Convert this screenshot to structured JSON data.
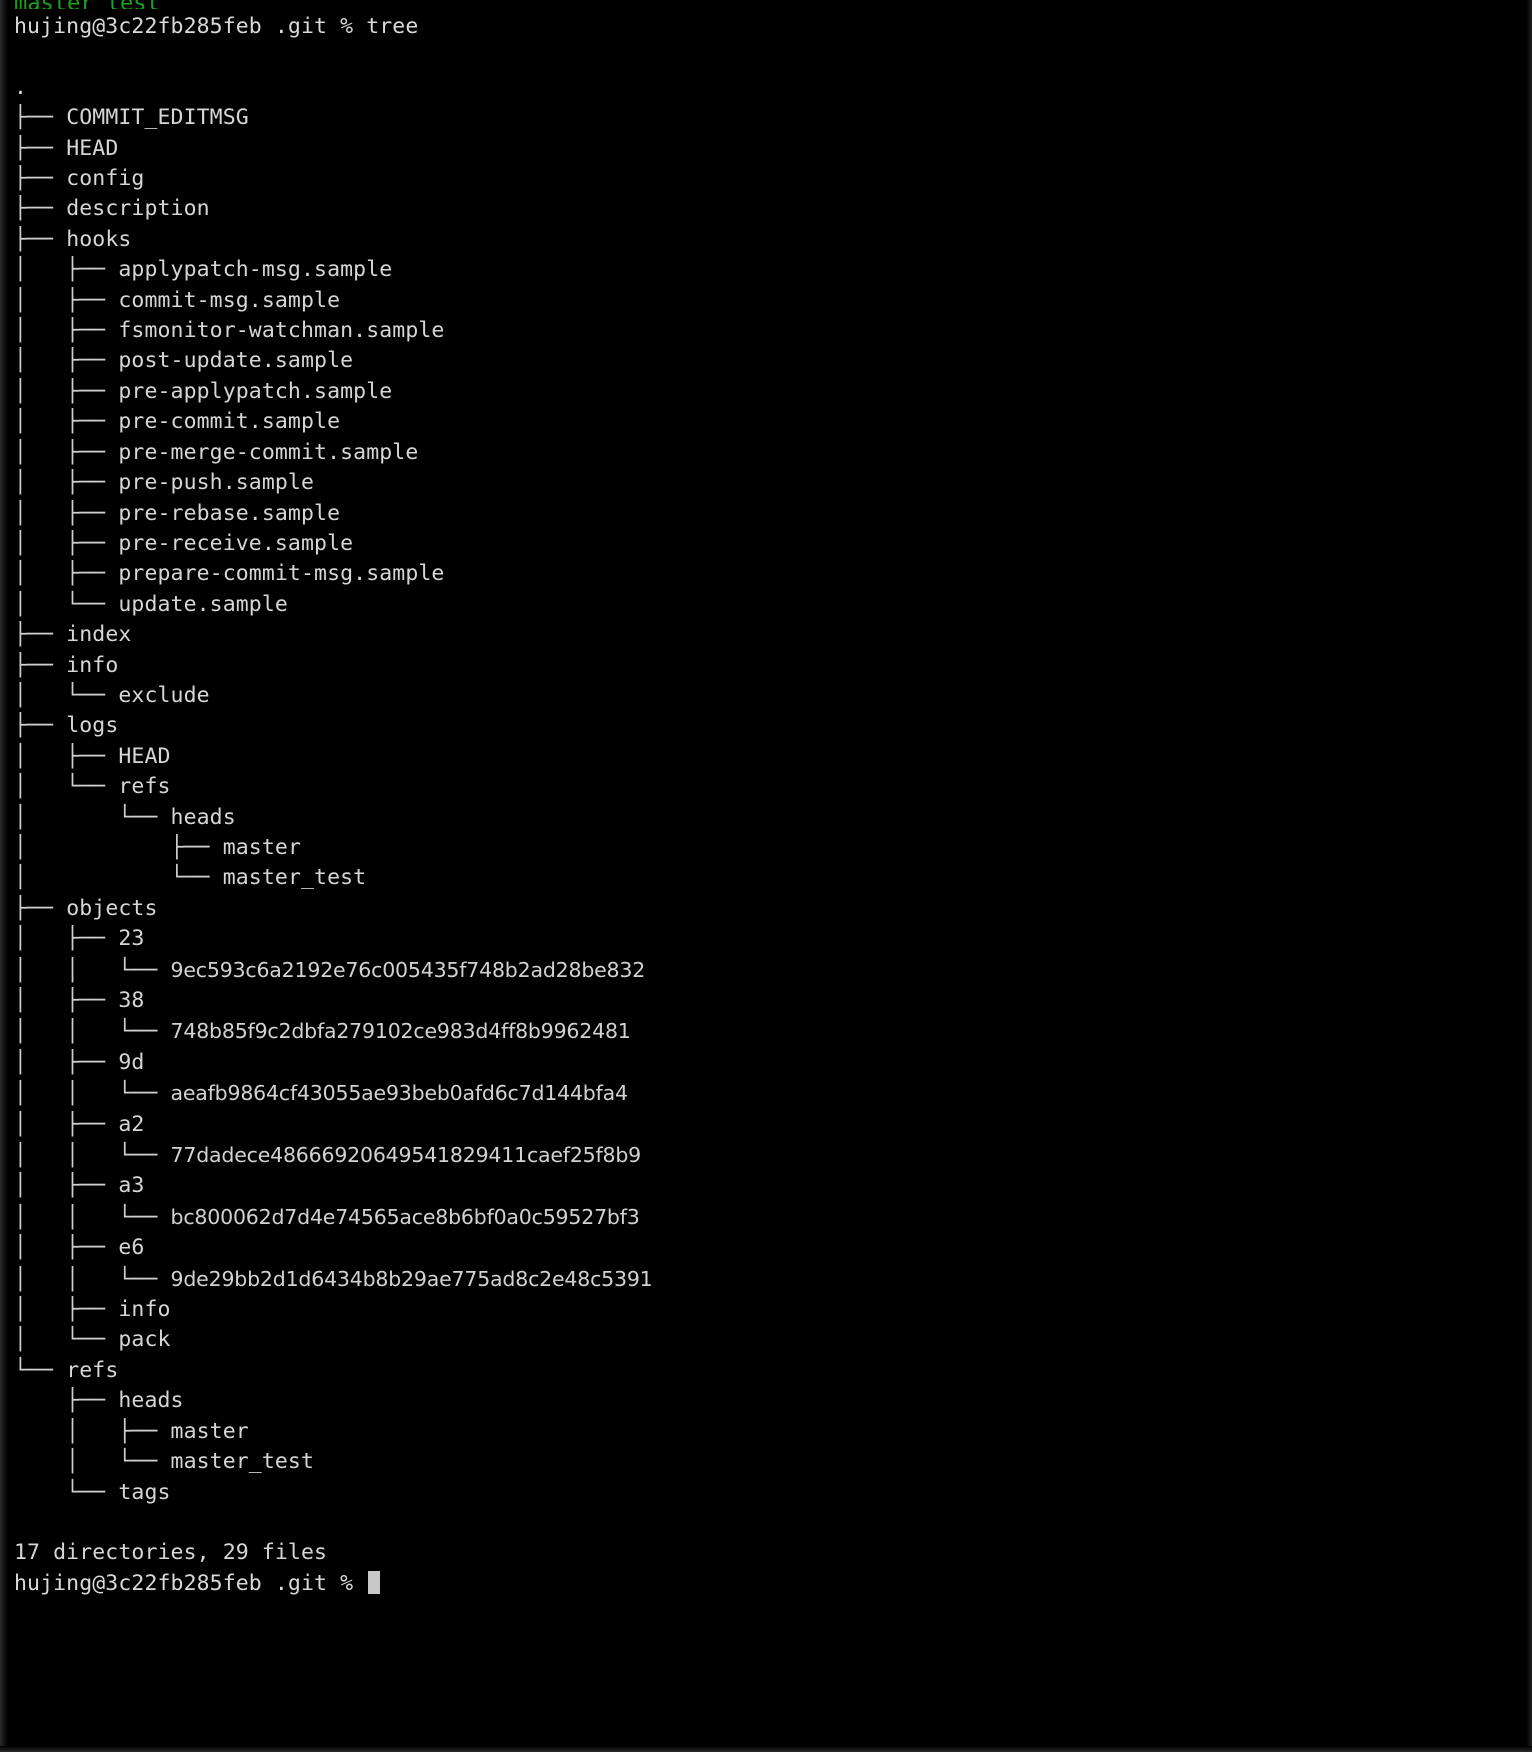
{
  "terminal": {
    "window_title_clipped": "master_test",
    "colors": {
      "background": "#000000",
      "foreground": "#d6d6d6",
      "branch_green": "#19a31a",
      "cursor": "#c8c8c8"
    },
    "prompt_user_host": "hujing@3c22fb285feb",
    "prompt_cwd": ".git",
    "prompt_symbol": "%",
    "command": "tree",
    "command_line": "hujing@3c22fb285feb .git % tree",
    "root": ".",
    "summary": "17 directories, 29 files",
    "directories_count": 17,
    "files_count": 29,
    "final_prompt": "hujing@3c22fb285feb .git % "
  },
  "tree_lines": [
    {
      "guide": "",
      "name": ".",
      "style": "plain"
    },
    {
      "guide": "├── ",
      "name": "COMMIT_EDITMSG",
      "style": "plain"
    },
    {
      "guide": "├── ",
      "name": "HEAD",
      "style": "plain"
    },
    {
      "guide": "├── ",
      "name": "config",
      "style": "plain"
    },
    {
      "guide": "├── ",
      "name": "description",
      "style": "plain"
    },
    {
      "guide": "├── ",
      "name": "hooks",
      "style": "plain"
    },
    {
      "guide": "│   ├── ",
      "name": "applypatch-msg.sample",
      "style": "plain"
    },
    {
      "guide": "│   ├── ",
      "name": "commit-msg.sample",
      "style": "plain"
    },
    {
      "guide": "│   ├── ",
      "name": "fsmonitor-watchman.sample",
      "style": "plain"
    },
    {
      "guide": "│   ├── ",
      "name": "post-update.sample",
      "style": "plain"
    },
    {
      "guide": "│   ├── ",
      "name": "pre-applypatch.sample",
      "style": "plain"
    },
    {
      "guide": "│   ├── ",
      "name": "pre-commit.sample",
      "style": "plain"
    },
    {
      "guide": "│   ├── ",
      "name": "pre-merge-commit.sample",
      "style": "plain"
    },
    {
      "guide": "│   ├── ",
      "name": "pre-push.sample",
      "style": "plain"
    },
    {
      "guide": "│   ├── ",
      "name": "pre-rebase.sample",
      "style": "plain"
    },
    {
      "guide": "│   ├── ",
      "name": "pre-receive.sample",
      "style": "plain"
    },
    {
      "guide": "│   ├── ",
      "name": "prepare-commit-msg.sample",
      "style": "plain"
    },
    {
      "guide": "│   └── ",
      "name": "update.sample",
      "style": "plain"
    },
    {
      "guide": "├── ",
      "name": "index",
      "style": "plain"
    },
    {
      "guide": "├── ",
      "name": "info",
      "style": "plain"
    },
    {
      "guide": "│   └── ",
      "name": "exclude",
      "style": "plain"
    },
    {
      "guide": "├── ",
      "name": "logs",
      "style": "plain"
    },
    {
      "guide": "│   ├── ",
      "name": "HEAD",
      "style": "plain"
    },
    {
      "guide": "│   └── ",
      "name": "refs",
      "style": "plain"
    },
    {
      "guide": "│       └── ",
      "name": "heads",
      "style": "plain"
    },
    {
      "guide": "│           ├── ",
      "name": "master",
      "style": "plain"
    },
    {
      "guide": "│           └── ",
      "name": "master_test",
      "style": "plain"
    },
    {
      "guide": "├── ",
      "name": "objects",
      "style": "plain"
    },
    {
      "guide": "│   ├── ",
      "name": "23",
      "style": "plain"
    },
    {
      "guide": "│   │   └── ",
      "name": "9ec593c6a2192e76c005435f748b2ad28be832",
      "style": "hash"
    },
    {
      "guide": "│   ├── ",
      "name": "38",
      "style": "plain"
    },
    {
      "guide": "│   │   └── ",
      "name": "748b85f9c2dbfa279102ce983d4ff8b9962481",
      "style": "hash"
    },
    {
      "guide": "│   ├── ",
      "name": "9d",
      "style": "plain"
    },
    {
      "guide": "│   │   └── ",
      "name": "aeafb9864cf43055ae93beb0afd6c7d144bfa4",
      "style": "hash"
    },
    {
      "guide": "│   ├── ",
      "name": "a2",
      "style": "plain"
    },
    {
      "guide": "│   │   └── ",
      "name": "77dadece48666920649541829411caef25f8b9",
      "style": "hash"
    },
    {
      "guide": "│   ├── ",
      "name": "a3",
      "style": "plain"
    },
    {
      "guide": "│   │   └── ",
      "name": "bc800062d7d4e74565ace8b6bf0a0c59527bf3",
      "style": "hash"
    },
    {
      "guide": "│   ├── ",
      "name": "e6",
      "style": "plain"
    },
    {
      "guide": "│   │   └── ",
      "name": "9de29bb2d1d6434b8b29ae775ad8c2e48c5391",
      "style": "hash"
    },
    {
      "guide": "│   ├── ",
      "name": "info",
      "style": "plain"
    },
    {
      "guide": "│   └── ",
      "name": "pack",
      "style": "plain"
    },
    {
      "guide": "└── ",
      "name": "refs",
      "style": "plain"
    },
    {
      "guide": "    ├── ",
      "name": "heads",
      "style": "plain"
    },
    {
      "guide": "    │   ├── ",
      "name": "master",
      "style": "plain"
    },
    {
      "guide": "    │   └── ",
      "name": "master_test",
      "style": "plain"
    },
    {
      "guide": "    └── ",
      "name": "tags",
      "style": "plain"
    }
  ]
}
